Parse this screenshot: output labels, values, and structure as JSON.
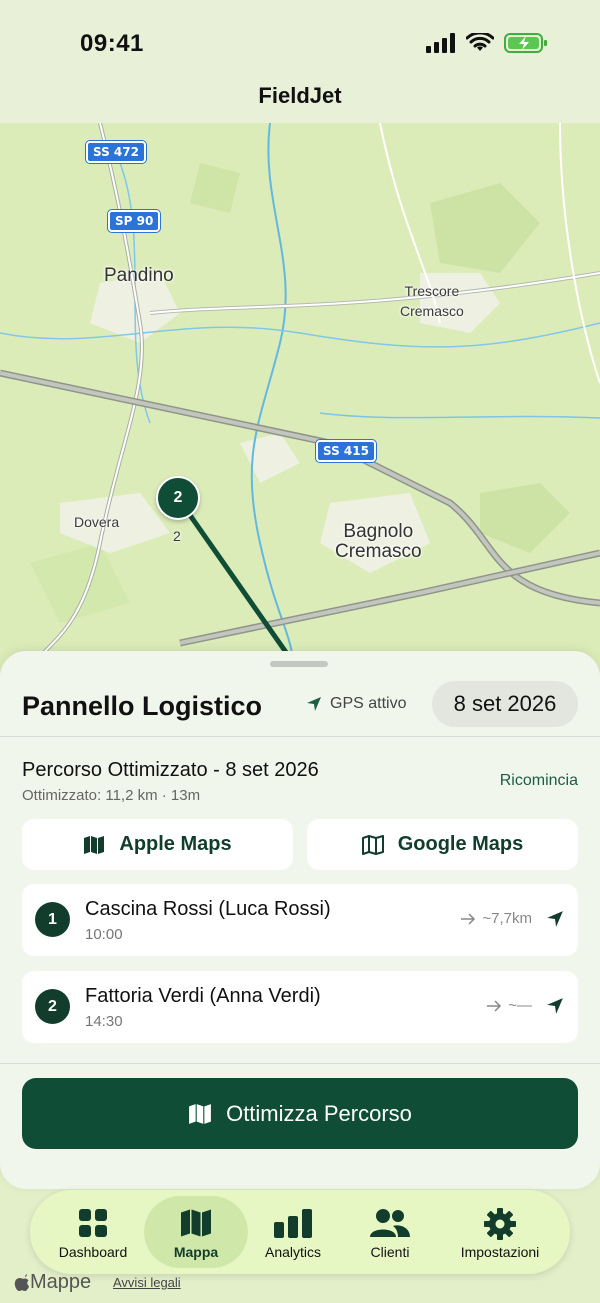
{
  "status_bar": {
    "time": "09:41"
  },
  "header": {
    "title": "FieldJet"
  },
  "map": {
    "road_shields": [
      "SS 472",
      "SP 90",
      "SS 415"
    ],
    "places": {
      "pandino": "Pandino",
      "trescore": "Trescore\nCremasco",
      "dovera": "Dovera",
      "dovera_sub": "2",
      "bagnolo": "Bagnolo\nCremasco"
    },
    "pins": [
      {
        "label": "2"
      }
    ]
  },
  "panel": {
    "title": "Pannello Logistico",
    "gps_label": "GPS attivo",
    "date": "8 set 2026",
    "route_title": "Percorso Ottimizzato - 8 set 2026",
    "route_sub": "Ottimizzato: 11,2 km · 13m",
    "restart_label": "Ricomincia",
    "apple_maps_label": "Apple Maps",
    "google_maps_label": "Google Maps",
    "stops": [
      {
        "num": "1",
        "name": "Cascina Rossi (Luca Rossi)",
        "time": "10:00",
        "dist": "~7,7km"
      },
      {
        "num": "2",
        "name": "Fattoria Verdi (Anna Verdi)",
        "time": "14:30",
        "dist": "~—"
      }
    ],
    "optimize_label": "Ottimizza Percorso"
  },
  "tabbar": {
    "items": [
      {
        "label": "Dashboard",
        "icon": "grid-icon"
      },
      {
        "label": "Mappa",
        "icon": "map-icon",
        "active": true
      },
      {
        "label": "Analytics",
        "icon": "bar-chart-icon"
      },
      {
        "label": "Clienti",
        "icon": "people-icon"
      },
      {
        "label": "Impostazioni",
        "icon": "gear-icon"
      }
    ]
  },
  "footer": {
    "maps_label": "Mappe",
    "legal_label": "Avvisi legali"
  },
  "colors": {
    "accent": "#0f4d37",
    "background": "#e3efc9",
    "tab_active": "#cfe7a8",
    "shield": "#2a73d8"
  }
}
